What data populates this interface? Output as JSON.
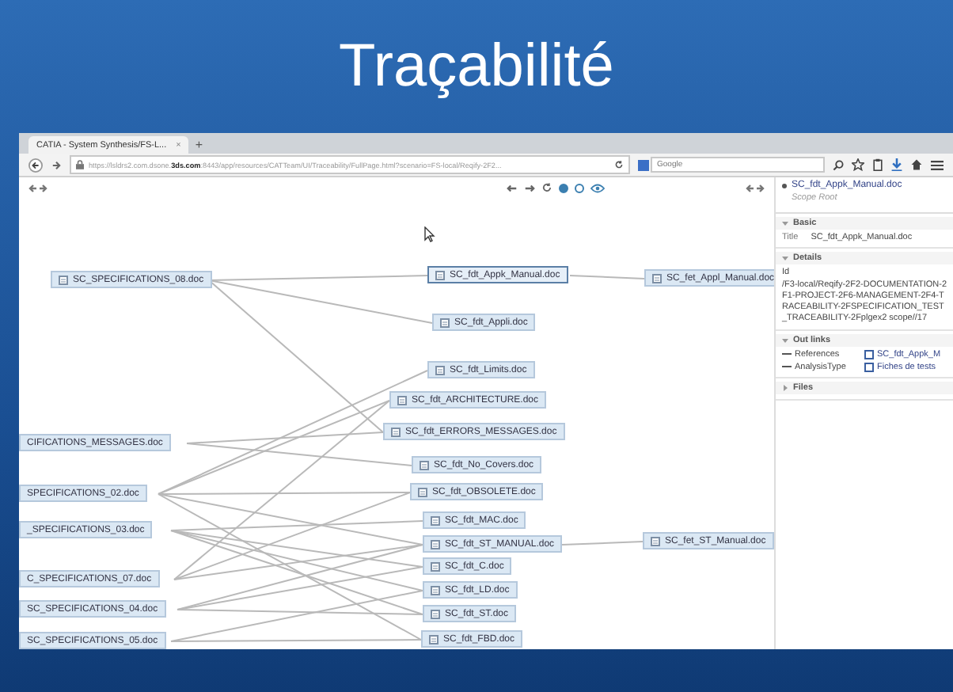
{
  "slide": {
    "title": "Traçabilité"
  },
  "browser": {
    "tab": {
      "title": "CATIA - System Synthesis/FS-L...",
      "close": "×"
    },
    "new_tab": "+",
    "url": "https://lsldrs2.com.dsone.**3ds.com**:8443/app/resources/CATTeam/UI/Traceability/FullPage.html?scenario=FS-local/Reqify-2F2...",
    "search": {
      "placeholder": "Google"
    }
  },
  "view_toggle": [
    {
      "selected": true
    },
    {
      "selected": false
    }
  ],
  "graph": {
    "nodes": [
      {
        "label": "SC_SPECIFICATIONS_08.doc",
        "selected": false
      },
      {
        "label": "CIFICATIONS_MESSAGES.doc",
        "selected": false
      },
      {
        "label": "SPECIFICATIONS_02.doc",
        "selected": false
      },
      {
        "label": "_SPECIFICATIONS_03.doc",
        "selected": false
      },
      {
        "label": "C_SPECIFICATIONS_07.doc",
        "selected": false
      },
      {
        "label": "SC_SPECIFICATIONS_04.doc",
        "selected": false
      },
      {
        "label": "SC_SPECIFICATIONS_05.doc",
        "selected": false
      },
      {
        "label": "SC_fdt_Appk_Manual.doc",
        "selected": true
      },
      {
        "label": "SC_fet_Appl_Manual.doc",
        "selected": false
      },
      {
        "label": "SC_fdt_Appli.doc",
        "selected": false
      },
      {
        "label": "SC_fdt_Limits.doc",
        "selected": false
      },
      {
        "label": "SC_fdt_ARCHITECTURE.doc",
        "selected": false
      },
      {
        "label": "SC_fdt_ERRORS_MESSAGES.doc",
        "selected": false
      },
      {
        "label": "SC_fdt_No_Covers.doc",
        "selected": false
      },
      {
        "label": "SC_fdt_OBSOLETE.doc",
        "selected": false
      },
      {
        "label": "SC_fdt_MAC.doc",
        "selected": false
      },
      {
        "label": "SC_fdt_ST_MANUAL.doc",
        "selected": false
      },
      {
        "label": "SC_fet_ST_Manual.doc",
        "selected": false
      },
      {
        "label": "SC_fdt_C.doc",
        "selected": false
      },
      {
        "label": "SC_fdt_LD.doc",
        "selected": false
      },
      {
        "label": "SC_fdt_ST.doc",
        "selected": false
      },
      {
        "label": "SC_fdt_FBD.doc",
        "selected": false
      }
    ]
  },
  "details": {
    "name": "SC_fdt_Appk_Manual.doc",
    "scope": "Scope Root",
    "sections": [
      {
        "title": "Basic",
        "expanded": true,
        "kind": "fields",
        "fields": [
          {
            "label": "Title",
            "value": "SC_fdt_Appk_Manual.doc"
          }
        ]
      },
      {
        "title": "Details",
        "expanded": true,
        "kind": "text",
        "label": "Id",
        "text": "/F3-local/Reqify-2F2-DOCUMENTATION-2F1-PROJECT-2F6-MANAGEMENT-2F4-TRACEABILITY-2FSPECIFICATION_TEST_TRACEABILITY-2Fplgex2 scope//17"
      },
      {
        "title": "Out links",
        "expanded": true,
        "kind": "links",
        "links": [
          {
            "label": "References",
            "target": "SC_fdt_Appk_M"
          },
          {
            "label": "AnalysisType",
            "target": "Fiches de tests"
          }
        ]
      },
      {
        "title": "Files",
        "expanded": false
      }
    ]
  }
}
